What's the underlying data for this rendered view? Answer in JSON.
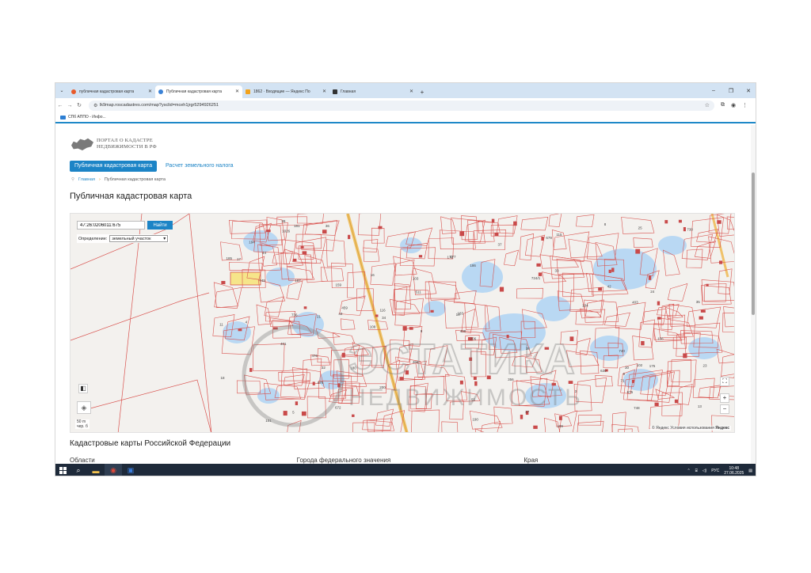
{
  "browser": {
    "tabs": [
      {
        "title": "публичная кадастровая карта",
        "color": "#e85a2a"
      },
      {
        "title": "Публичная кадастровая карта",
        "color": "#3b82d6"
      },
      {
        "title": "1862 · Входящие — Яндекс По",
        "color": "#f2a21c"
      },
      {
        "title": "Главная",
        "color": "#333333"
      }
    ],
    "url": "lk9map.roscadastres.com/map?ysclid=mceh1jrgr5294926251",
    "bookmark": "СПб АППО - Инфо..."
  },
  "site": {
    "logo_line1": "ПОРТАЛ О КАДАСТРЕ",
    "logo_line2": "НЕДВИЖИМОСТИ В РФ",
    "nav_active": "Публичная кадастровая карта",
    "nav_link": "Расчет земельного налога",
    "crumb_home": "Главная",
    "crumb_current": "Публичная кадастровая карта",
    "page_title": "Публичная кадастровая карта"
  },
  "map": {
    "search_value": "47:26:0206011:675",
    "search_button": "Найти",
    "definition_label": "Определение:",
    "definition_value": "земельный участок",
    "scale_value": "50 m",
    "scale_unit": "чер. б",
    "attribution": "© Яндекс Условия использования",
    "yandex_label": "Яндекс",
    "zoom_in": "+",
    "zoom_out": "−",
    "plot_labels": [
      "675",
      "672",
      "679",
      "677",
      "745",
      "740",
      "748",
      "736",
      "730",
      "724/1",
      "630",
      "466",
      "476",
      "459",
      "53",
      "24",
      "13",
      "27",
      "23",
      "21",
      "17",
      "25",
      "34",
      "39",
      "30",
      "33",
      "32",
      "36",
      "37",
      "38",
      "511",
      "116",
      "115",
      "109",
      "108",
      "104",
      "103",
      "102",
      "101",
      "156",
      "159",
      "1026",
      "172",
      "175",
      "181",
      "183",
      "185",
      "186",
      "180",
      "194",
      "190",
      "187",
      "200",
      "206",
      "400",
      "401",
      "403",
      "356",
      "675",
      "71",
      "42",
      "3",
      "8",
      "9",
      "5",
      "4",
      "6",
      "10",
      "11",
      "16",
      "18",
      "35",
      "43",
      "44"
    ],
    "watermark_line1": "ЭСТАТИКА",
    "watermark_line2": "НЕДВИЖИМОСТЬ"
  },
  "section": {
    "title": "Кадастровые карты Российской Федерации",
    "col1": "Области",
    "col2": "Города федерального значения",
    "col3": "Края"
  },
  "taskbar": {
    "lang": "РУС",
    "time": "10:48",
    "date": "27.06.2025"
  }
}
